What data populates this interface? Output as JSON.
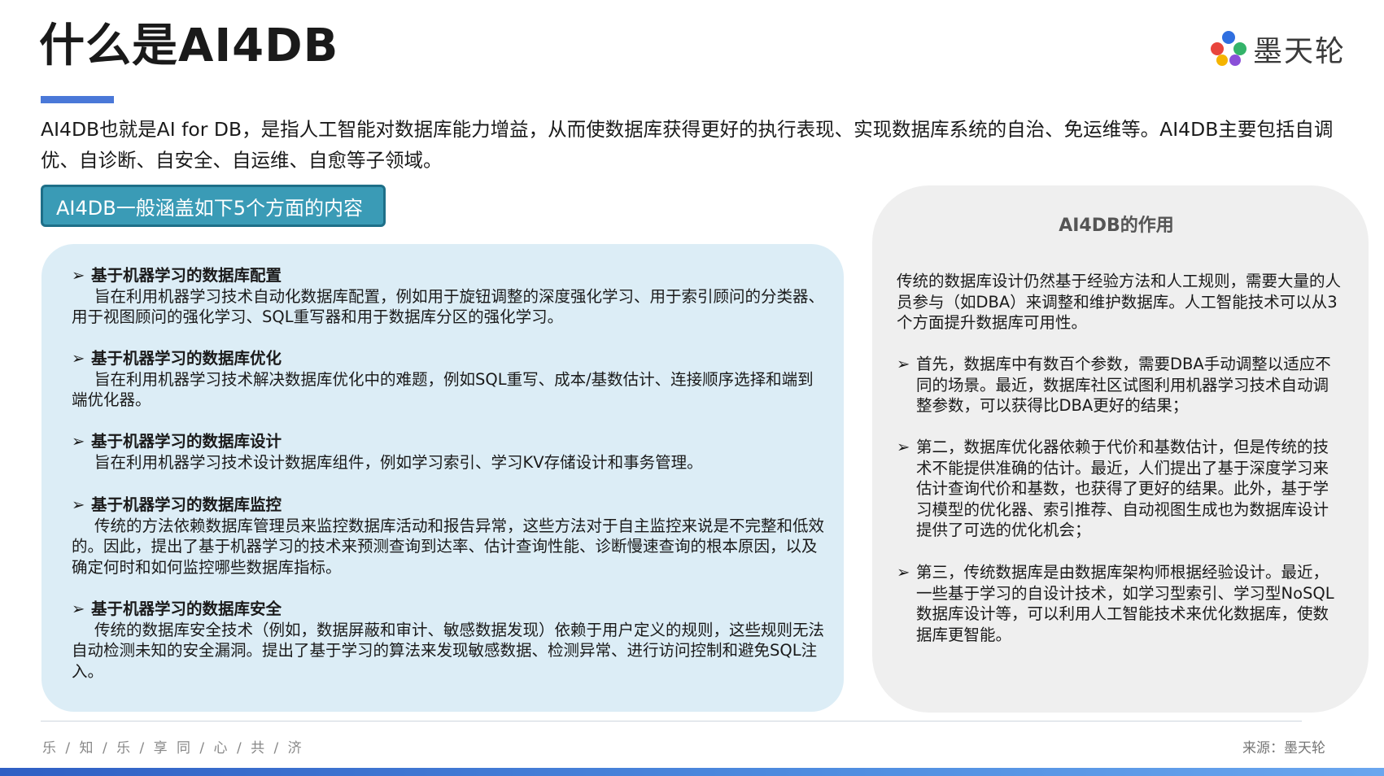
{
  "header": {
    "title": "什么是AI4DB",
    "logo_text": "墨天轮",
    "logo_icon": "motianlun-logo-icon"
  },
  "intro": "AI4DB也就是AI for DB，是指人工智能对数据库能力增益，从而使数据库获得更好的执行表现、实现数据库系统的自治、免运维等。AI4DB主要包括自调优、自诊断、自安全、自运维、自愈等子领域。",
  "tag_label": "AI4DB一般涵盖如下5个方面的内容",
  "bullet_glyph": "➢",
  "aspects": [
    {
      "title": "基于机器学习的数据库配置",
      "body": "旨在利用机器学习技术自动化数据库配置，例如用于旋钮调整的深度强化学习、用于索引顾问的分类器、用于视图顾问的强化学习、SQL重写器和用于数据库分区的强化学习。"
    },
    {
      "title": "基于机器学习的数据库优化",
      "body": "旨在利用机器学习技术解决数据库优化中的难题，例如SQL重写、成本/基数估计、连接顺序选择和端到端优化器。"
    },
    {
      "title": "基于机器学习的数据库设计",
      "body": "旨在利用机器学习技术设计数据库组件，例如学习索引、学习KV存储设计和事务管理。"
    },
    {
      "title": "基于机器学习的数据库监控",
      "body": "传统的方法依赖数据库管理员来监控数据库活动和报告异常，这些方法对于自主监控来说是不完整和低效的。因此，提出了基于机器学习的技术来预测查询到达率、估计查询性能、诊断慢速查询的根本原因，以及确定何时和如何监控哪些数据库指标。"
    },
    {
      "title": "基于机器学习的数据库安全",
      "body": "传统的数据库安全技术（例如，数据屏蔽和审计、敏感数据发现）依赖于用户定义的规则，这些规则无法自动检测未知的安全漏洞。提出了基于学习的算法来发现敏感数据、检测异常、进行访问控制和避免SQL注入。"
    }
  ],
  "role_panel": {
    "title": "AI4DB的作用",
    "intro": "传统的数据库设计仍然基于经验方法和人工规则，需要大量的人员参与（如DBA）来调整和维护数据库。人工智能技术可以从3个方面提升数据库可用性。",
    "points": [
      "首先，数据库中有数百个参数，需要DBA手动调整以适应不同的场景。最近，数据库社区试图利用机器学习技术自动调整参数，可以获得比DBA更好的结果；",
      "第二，数据库优化器依赖于代价和基数估计，但是传统的技术不能提供准确的估计。最近，人们提出了基于深度学习来估计查询代价和基数，也获得了更好的结果。此外，基于学习模型的优化器、索引推荐、自动视图生成也为数据库设计提供了可选的优化机会；",
      "第三，传统数据库是由数据库架构师根据经验设计。最近，一些基于学习的自设计技术，如学习型索引、学习型NoSQL数据库设计等，可以利用人工智能技术来优化数据库，使数据库更智能。"
    ]
  },
  "footer": {
    "left": "乐 / 知 / 乐 / 享       同 / 心 / 共 / 济",
    "right": "来源：墨天轮"
  },
  "colors": {
    "accent_blue": "#4a78d8",
    "tag_teal": "#3a9bb6",
    "left_panel_bg": "#dcedf6",
    "right_panel_bg": "#efefef"
  }
}
